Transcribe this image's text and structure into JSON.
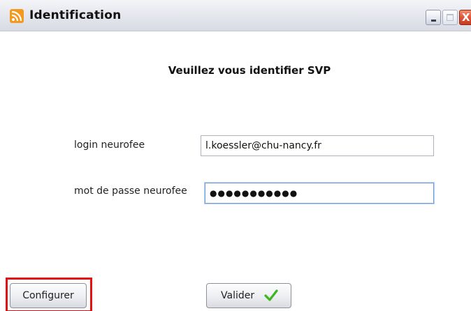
{
  "window": {
    "title": "Identification",
    "app_icon": "rss-feed-icon",
    "controls": {
      "minimize": "minimize-icon",
      "maximize": "maximize-icon",
      "close": "close-icon",
      "close_glyph": "X"
    }
  },
  "form": {
    "heading": "Veuillez vous identifier SVP",
    "login_label": "login neurofee",
    "login_value": "l.koessler@chu-nancy.fr",
    "password_label": "mot de passe neurofee",
    "password_value": "●●●●●●●●●●●"
  },
  "buttons": {
    "configure_label": "Configurer",
    "validate_label": "Valider",
    "validate_icon": "checkmark-icon"
  },
  "colors": {
    "highlight": "#e31212",
    "checkmark": "#3db51e",
    "close_button": "#e2553a",
    "focus_border": "#6d9ed9"
  }
}
